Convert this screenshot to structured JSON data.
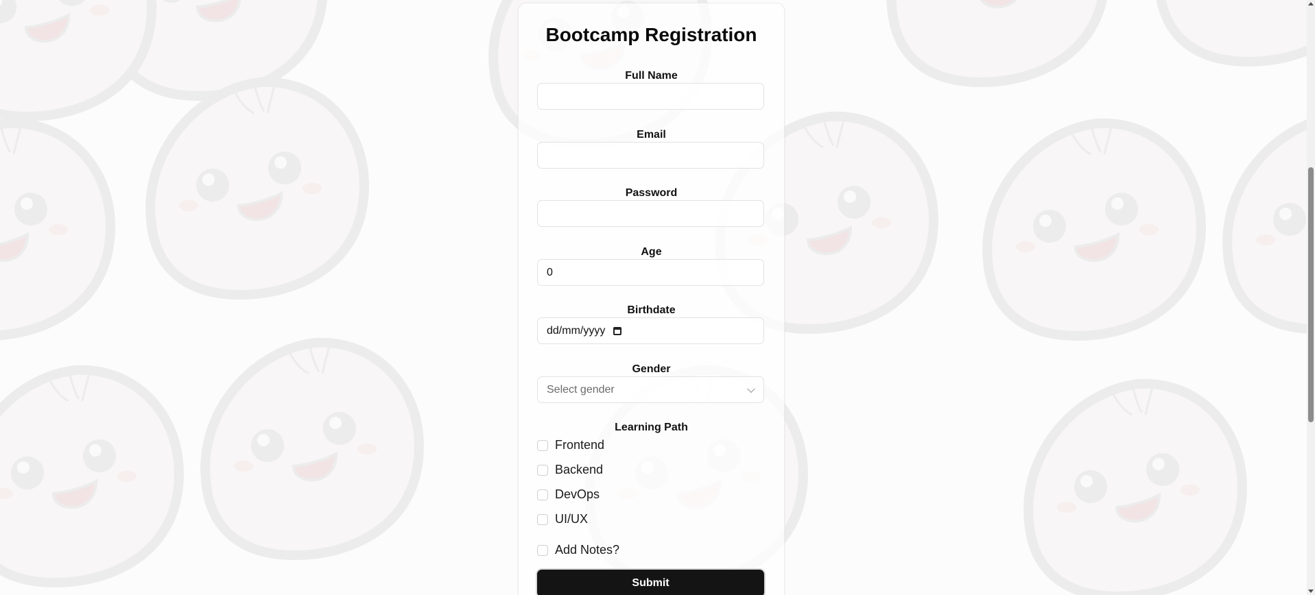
{
  "form": {
    "title": "Bootcamp Registration",
    "fields": {
      "full_name": {
        "label": "Full Name",
        "value": ""
      },
      "email": {
        "label": "Email",
        "value": ""
      },
      "password": {
        "label": "Password",
        "value": ""
      },
      "age": {
        "label": "Age",
        "value": "0"
      },
      "birthdate": {
        "label": "Birthdate",
        "value": "dd/mm/yyyy"
      },
      "gender": {
        "label": "Gender",
        "placeholder": "Select gender"
      }
    },
    "learning_path": {
      "label": "Learning Path",
      "options": [
        "Frontend",
        "Backend",
        "DevOps",
        "UI/UX"
      ]
    },
    "add_notes_label": "Add Notes?",
    "submit_label": "Submit"
  },
  "colors": {
    "submit_bg": "#141414",
    "pattern": "#ececec",
    "page_bg": "#fdfcfc"
  },
  "icons": {
    "birthdate": "calendar-icon",
    "gender": "chevron-down-icon",
    "background": "dumpling-mascot-pattern"
  }
}
